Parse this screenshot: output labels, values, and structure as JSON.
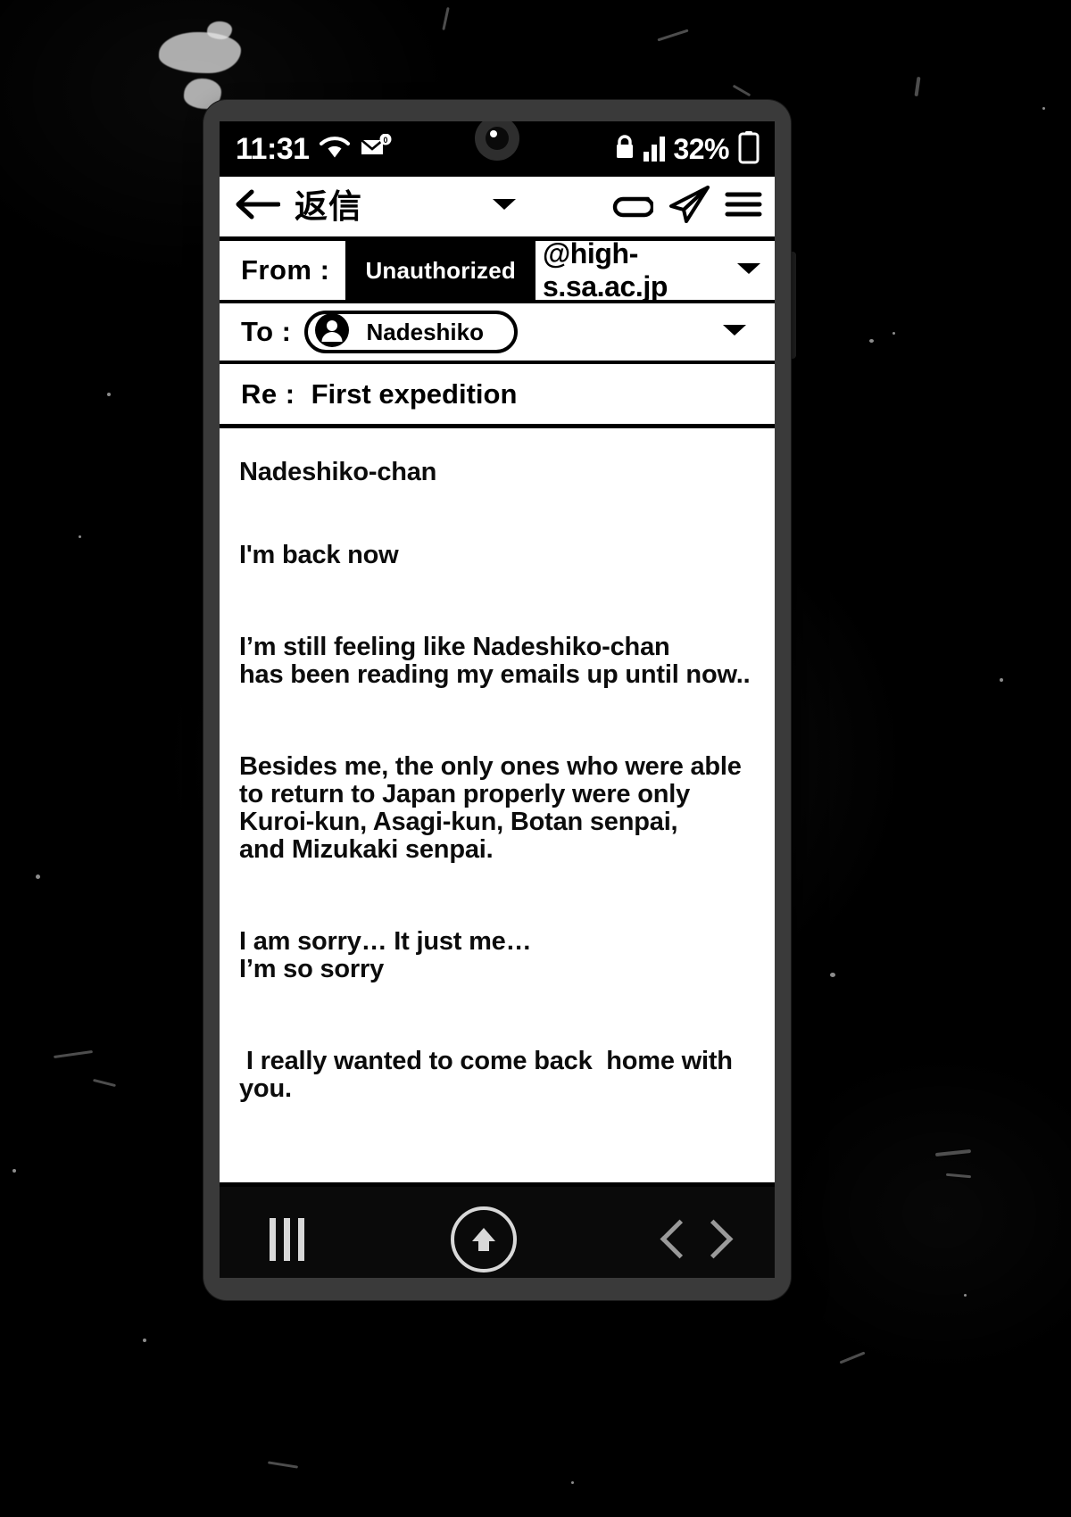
{
  "scene": {
    "description": "manga-style phone mockup on dark scratched background"
  },
  "phone": {
    "status_bar": {
      "clock": "11:31",
      "wifi_icon": "wifi-icon",
      "mail_icon": "unread-mail-icon",
      "mail_badge": "0",
      "lock_icon": "lock-icon",
      "signal_icon": "signal-bars-icon",
      "battery_percent": "32%",
      "battery_icon": "battery-icon"
    },
    "toolbar": {
      "back_icon": "back-arrow-icon",
      "title": "返信",
      "dropdown_icon": "chevron-down-icon",
      "attach_icon": "attachment-icon",
      "send_icon": "send-paper-plane-icon",
      "menu_icon": "hamburger-menu-icon"
    },
    "compose": {
      "from_label": "From :",
      "from_user": "Unauthorized",
      "from_domain": "@high-s.sa.ac.jp",
      "from_dropdown_icon": "chevron-down-icon",
      "to_label": "To :",
      "to_chip_avatar_icon": "person-avatar-icon",
      "to_chip_name": "Nadeshiko",
      "to_dropdown_icon": "chevron-down-icon",
      "subject_label": "Re :",
      "subject_value": "First expedition"
    },
    "body": {
      "paragraphs": [
        {
          "lines": [
            "Nadeshiko-chan"
          ]
        },
        {
          "lines": [
            "I'm back now"
          ]
        },
        {
          "lines": [
            "I’m still feeling like Nadeshiko-chan",
            "has been reading my emails up until now.."
          ]
        },
        {
          "lines": [
            "Besides me, the only ones who were able",
            "to return to Japan properly were only",
            "Kuroi-kun, Asagi-kun, Botan senpai,",
            "and Mizukaki senpai."
          ]
        },
        {
          "lines": [
            "I am sorry… It just me…",
            "I’m so sorry"
          ]
        },
        {
          "lines": [
            " I really wanted to come back  home with you."
          ]
        }
      ]
    },
    "navbar": {
      "recents_icon": "recents-bars-icon",
      "home_icon": "home-up-arrow-icon",
      "back_icon": "chevron-left-icon",
      "forward_icon": "chevron-right-icon"
    }
  },
  "colors": {
    "screen_bg": "#ffffff",
    "chrome_black": "#000000",
    "phone_frame": "#3a3a3a",
    "nav_icon": "#d8d8d8",
    "backdrop": "#050505"
  }
}
